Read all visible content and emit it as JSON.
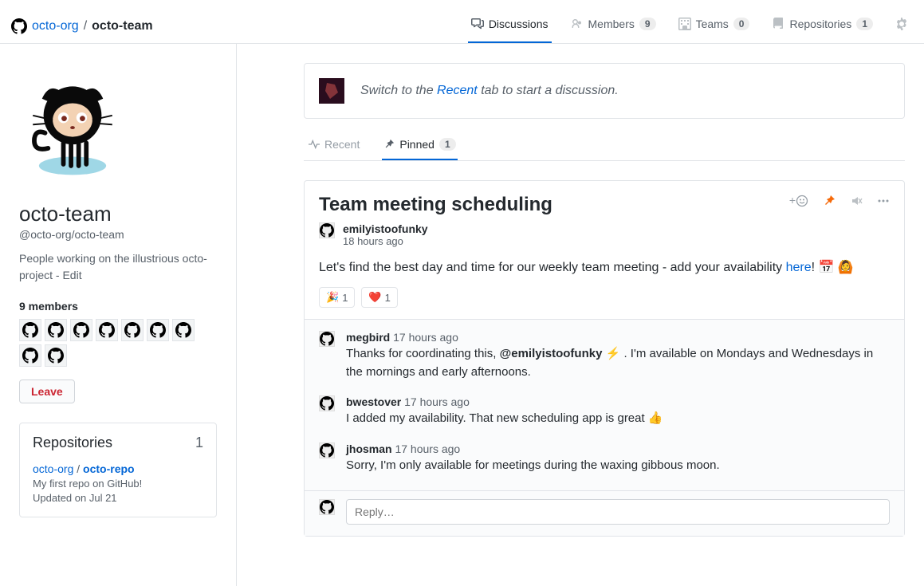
{
  "breadcrumb": {
    "org": "octo-org",
    "team": "octo-team"
  },
  "tabs": {
    "discussions": "Discussions",
    "members": "Members",
    "members_count": "9",
    "teams": "Teams",
    "teams_count": "0",
    "repositories": "Repositories",
    "repositories_count": "1"
  },
  "sidebar": {
    "team_name": "octo-team",
    "team_slug": "@octo-org/octo-team",
    "team_desc": "People working on the illustrious octo-project - Edit",
    "members_heading": "9 members",
    "leave_label": "Leave",
    "repos_heading": "Repositories",
    "repos_count": "1",
    "repo_org": "octo-org",
    "repo_name": "octo-repo",
    "repo_desc": "My first repo on GitHub!",
    "repo_updated": "Updated on Jul 21"
  },
  "banner": {
    "prefix": "Switch to the ",
    "link": "Recent",
    "suffix": " tab to start a discussion."
  },
  "subtabs": {
    "recent": "Recent",
    "pinned": "Pinned",
    "pinned_count": "1"
  },
  "post": {
    "title": "Team meeting scheduling",
    "author": "emilyistoofunky",
    "time": "18 hours ago",
    "body_prefix": "Let's find the best day and time for our weekly team meeting - add your availability ",
    "body_link": "here",
    "body_suffix": "! 📅 🙆",
    "reactions": {
      "confetti": "🎉",
      "confetti_count": "1",
      "heart": "❤️",
      "heart_count": "1"
    }
  },
  "comments": [
    {
      "author": "megbird",
      "time": "17 hours ago",
      "text_prefix": "Thanks for coordinating this, ",
      "mention": "@emilyistoofunky",
      "text_suffix": " ⚡ . I'm available on Mondays and Wednesdays in the mornings and early afternoons."
    },
    {
      "author": "bwestover",
      "time": "17 hours ago",
      "text": "I added my availability. That new scheduling app is great 👍"
    },
    {
      "author": "jhosman",
      "time": "17 hours ago",
      "text": "Sorry, I'm only available for meetings during the waxing gibbous moon."
    }
  ],
  "reply": {
    "placeholder": "Reply…"
  }
}
